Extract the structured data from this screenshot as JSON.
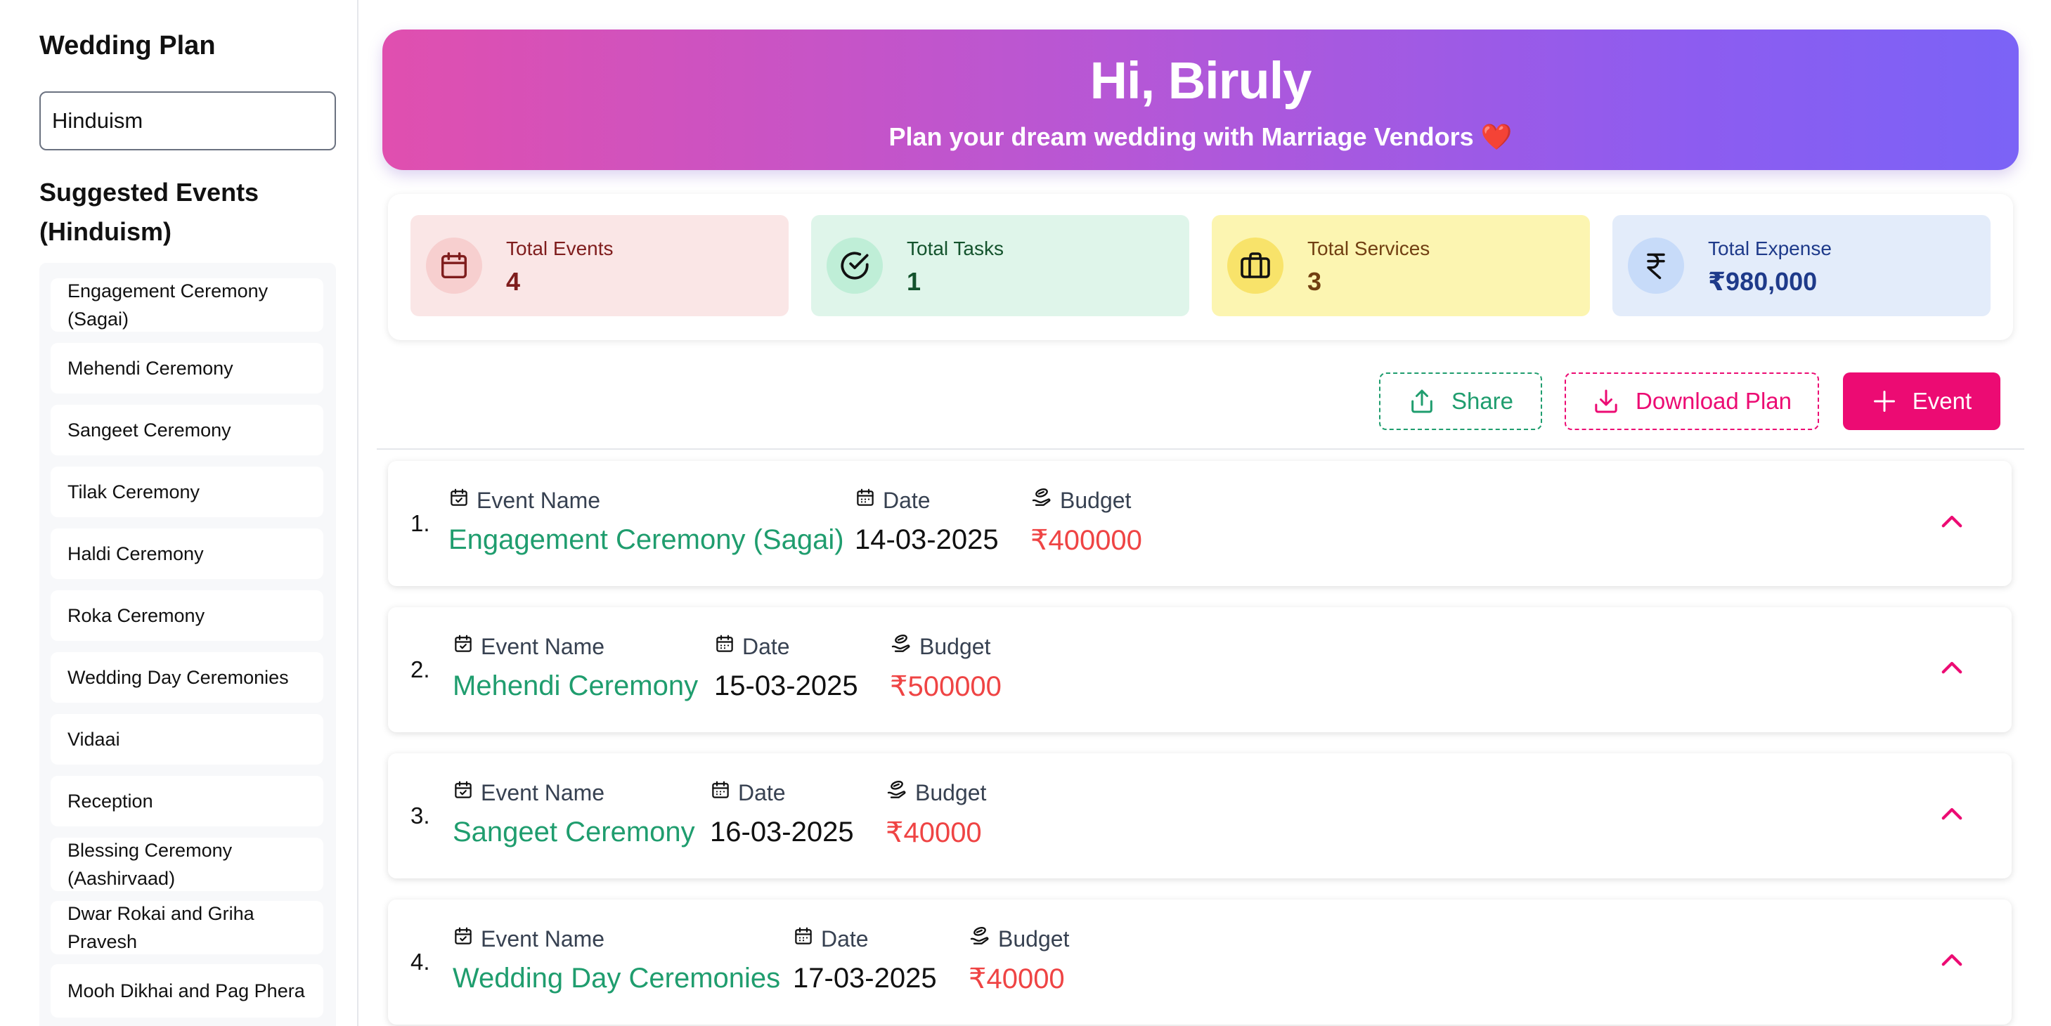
{
  "sidebar": {
    "title": "Wedding Plan",
    "religion_value": "Hinduism",
    "heading": "Suggested Events (Hinduism)",
    "items": [
      "Engagement Ceremony (Sagai)",
      "Mehendi Ceremony",
      "Sangeet Ceremony",
      "Tilak Ceremony",
      "Haldi Ceremony",
      "Roka Ceremony",
      "Wedding Day Ceremonies",
      "Vidaai",
      "Reception",
      "Blessing Ceremony (Aashirvaad)",
      "Dwar Rokai and Griha Pravesh",
      "Mooh Dikhai and Pag Phera"
    ]
  },
  "hero": {
    "title": "Hi, Biruly",
    "subtitle": "Plan your dream wedding with Marriage Vendors ❤️"
  },
  "stats": [
    {
      "label": "Total Events",
      "value": "4",
      "icon": "calendar-icon",
      "bg": "#fae6e6",
      "circle": "#f7cfcf",
      "text": "#7f1d1d"
    },
    {
      "label": "Total Tasks",
      "value": "1",
      "icon": "check-circle-icon",
      "bg": "#dff5ea",
      "circle": "#bfeed7",
      "text": "#14532d"
    },
    {
      "label": "Total Services",
      "value": "3",
      "icon": "briefcase-icon",
      "bg": "#fcf5b1",
      "circle": "#f8e36a",
      "text": "#713f12"
    },
    {
      "label": "Total Expense",
      "value": "₹980,000",
      "icon": "rupee-icon",
      "bg": "#e3ecfa",
      "circle": "#c7dbf9",
      "text": "#1e3a8a"
    }
  ],
  "actions": {
    "share": "Share",
    "download": "Download Plan",
    "add_event": "Event"
  },
  "events": [
    {
      "num": "1.",
      "name": "Engagement Ceremony (Sagai)",
      "date": "14-03-2025",
      "budget": "₹400000"
    },
    {
      "num": "2.",
      "name": "Mehendi Ceremony",
      "date": "15-03-2025",
      "budget": "₹500000"
    },
    {
      "num": "3.",
      "name": "Sangeet Ceremony",
      "date": "16-03-2025",
      "budget": "₹40000"
    },
    {
      "num": "4.",
      "name": "Wedding Day Ceremonies",
      "date": "17-03-2025",
      "budget": "₹40000"
    }
  ],
  "labels": {
    "event_name": "Event Name",
    "date": "Date",
    "budget": "Budget"
  },
  "colors": {
    "accent_pink": "#ec0b73",
    "accent_green": "#1f9d6e",
    "budget_red": "#ef4444"
  }
}
